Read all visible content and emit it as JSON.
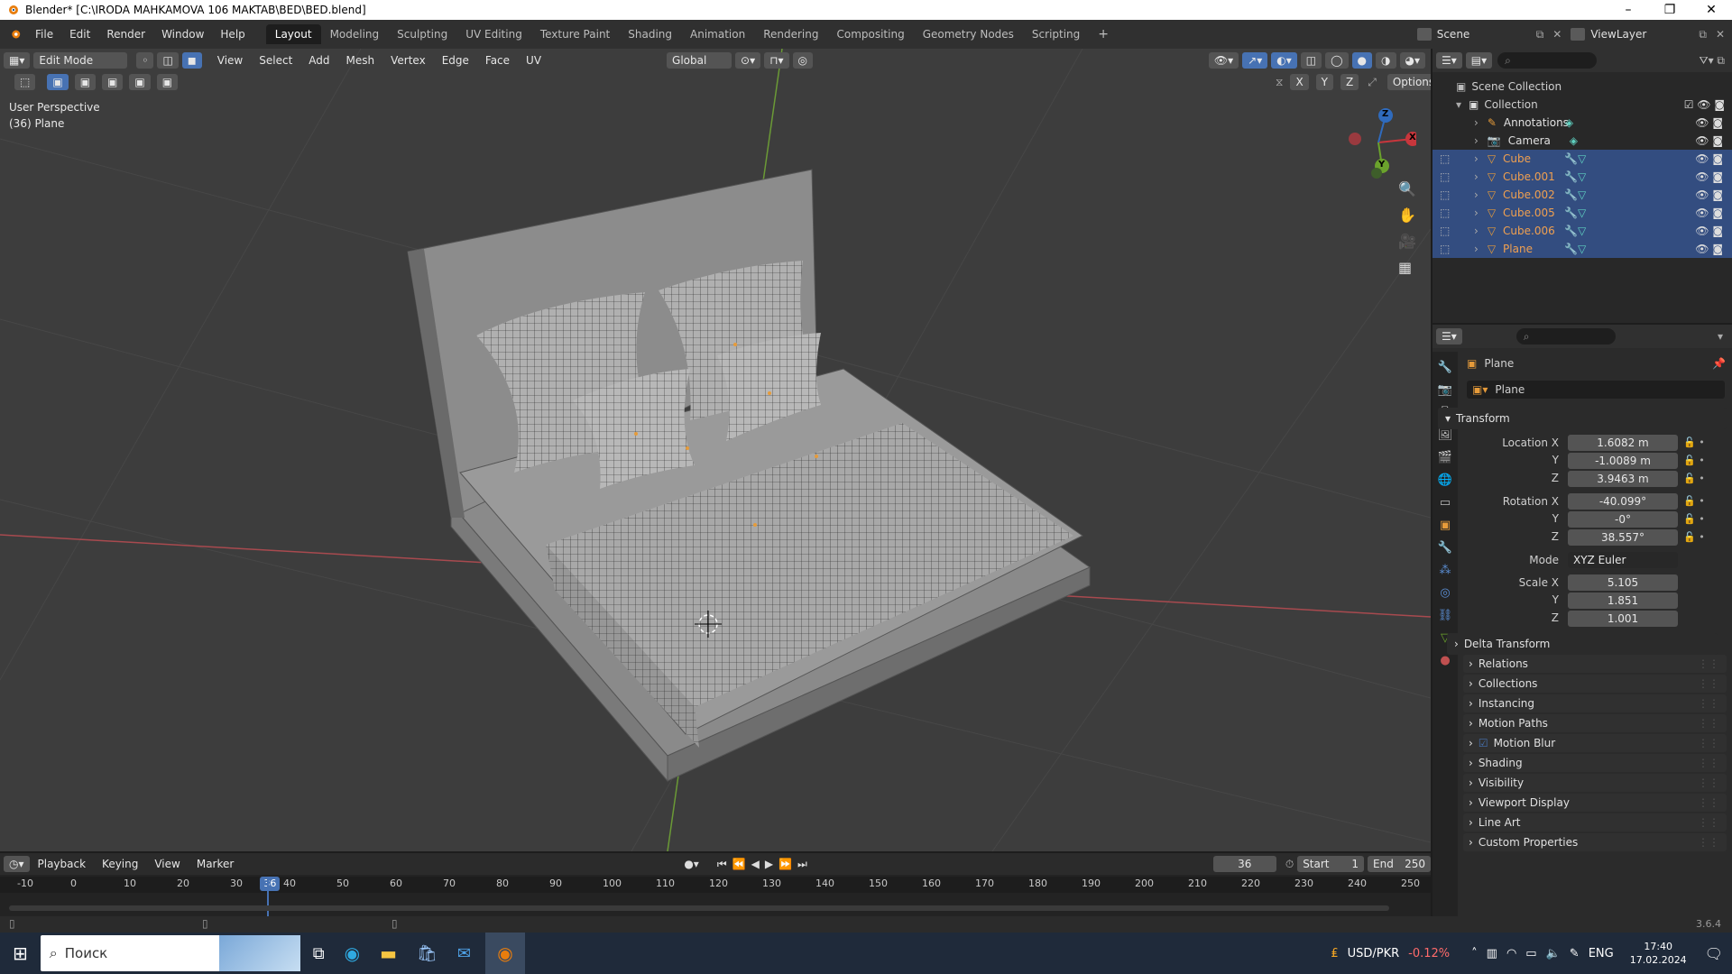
{
  "window": {
    "title": "Blender* [C:\\IRODA MAHKAMOVA 106 MAKTAB\\BED\\BED.blend]"
  },
  "menu": [
    "File",
    "Edit",
    "Render",
    "Window",
    "Help"
  ],
  "workspaces": [
    "Layout",
    "Modeling",
    "Sculpting",
    "UV Editing",
    "Texture Paint",
    "Shading",
    "Animation",
    "Rendering",
    "Compositing",
    "Geometry Nodes",
    "Scripting"
  ],
  "scene": {
    "name": "Scene",
    "view_layer": "ViewLayer"
  },
  "viewport_header": {
    "mode": "Edit Mode",
    "items": [
      "View",
      "Select",
      "Add",
      "Mesh",
      "Vertex",
      "Edge",
      "Face",
      "UV"
    ],
    "orientation": "Global",
    "options_label": "Options",
    "axes": [
      "X",
      "Y",
      "Z"
    ]
  },
  "viewport": {
    "perspective": "User Perspective",
    "object_info": "(36) Plane"
  },
  "gizmo": {
    "x": "X",
    "y": "Y",
    "z": "Z"
  },
  "outliner": {
    "root": "Scene Collection",
    "collection": "Collection",
    "items": [
      {
        "name": "Annotations",
        "selected": false
      },
      {
        "name": "Camera",
        "selected": false
      },
      {
        "name": "Cube",
        "selected": true
      },
      {
        "name": "Cube.001",
        "selected": true
      },
      {
        "name": "Cube.002",
        "selected": true
      },
      {
        "name": "Cube.005",
        "selected": true
      },
      {
        "name": "Cube.006",
        "selected": true
      },
      {
        "name": "Plane",
        "selected": true
      }
    ]
  },
  "properties": {
    "object_name": "Plane",
    "datablock": "Plane",
    "transform_label": "Transform",
    "location_label": "Location X",
    "location": [
      "1.6082 m",
      "-1.0089 m",
      "3.9463 m"
    ],
    "rotation_label": "Rotation X",
    "rotation": [
      "-40.099°",
      "-0°",
      "38.557°"
    ],
    "mode_label": "Mode",
    "mode": "XYZ Euler",
    "scale_label": "Scale X",
    "scale": [
      "5.105",
      "1.851",
      "1.001"
    ],
    "y_label": "Y",
    "z_label": "Z",
    "delta_transform": "Delta Transform",
    "panels": [
      "Relations",
      "Collections",
      "Instancing",
      "Motion Paths",
      "Motion Blur",
      "Shading",
      "Visibility",
      "Viewport Display",
      "Line Art",
      "Custom Properties"
    ]
  },
  "timeline": {
    "menus": [
      "Playback",
      "Keying",
      "View",
      "Marker"
    ],
    "current_frame": "36",
    "start_label": "Start",
    "start": "1",
    "end_label": "End",
    "end": "250",
    "ruler": [
      "-10",
      "0",
      "10",
      "20",
      "30",
      "40",
      "50",
      "60",
      "70",
      "80",
      "90",
      "100",
      "110",
      "120",
      "130",
      "140",
      "150",
      "160",
      "170",
      "180",
      "190",
      "200",
      "210",
      "220",
      "230",
      "240",
      "250"
    ]
  },
  "version": "3.6.4",
  "taskbar": {
    "search_placeholder": "Поиск",
    "ticker_name": "USD/PKR",
    "ticker_change": "-0.12%",
    "lang": "ENG",
    "time": "17:40",
    "date": "17.02.2024"
  },
  "colors": {
    "selection": "#334d80",
    "accent": "#4772b3",
    "frame": "#4772b3",
    "x_axis": "#c8363c",
    "y_axis": "#6ba32c",
    "z_axis": "#2f6bbd",
    "ticker_negative": "#ff6b6b",
    "object_orange": "#e69b3a"
  }
}
